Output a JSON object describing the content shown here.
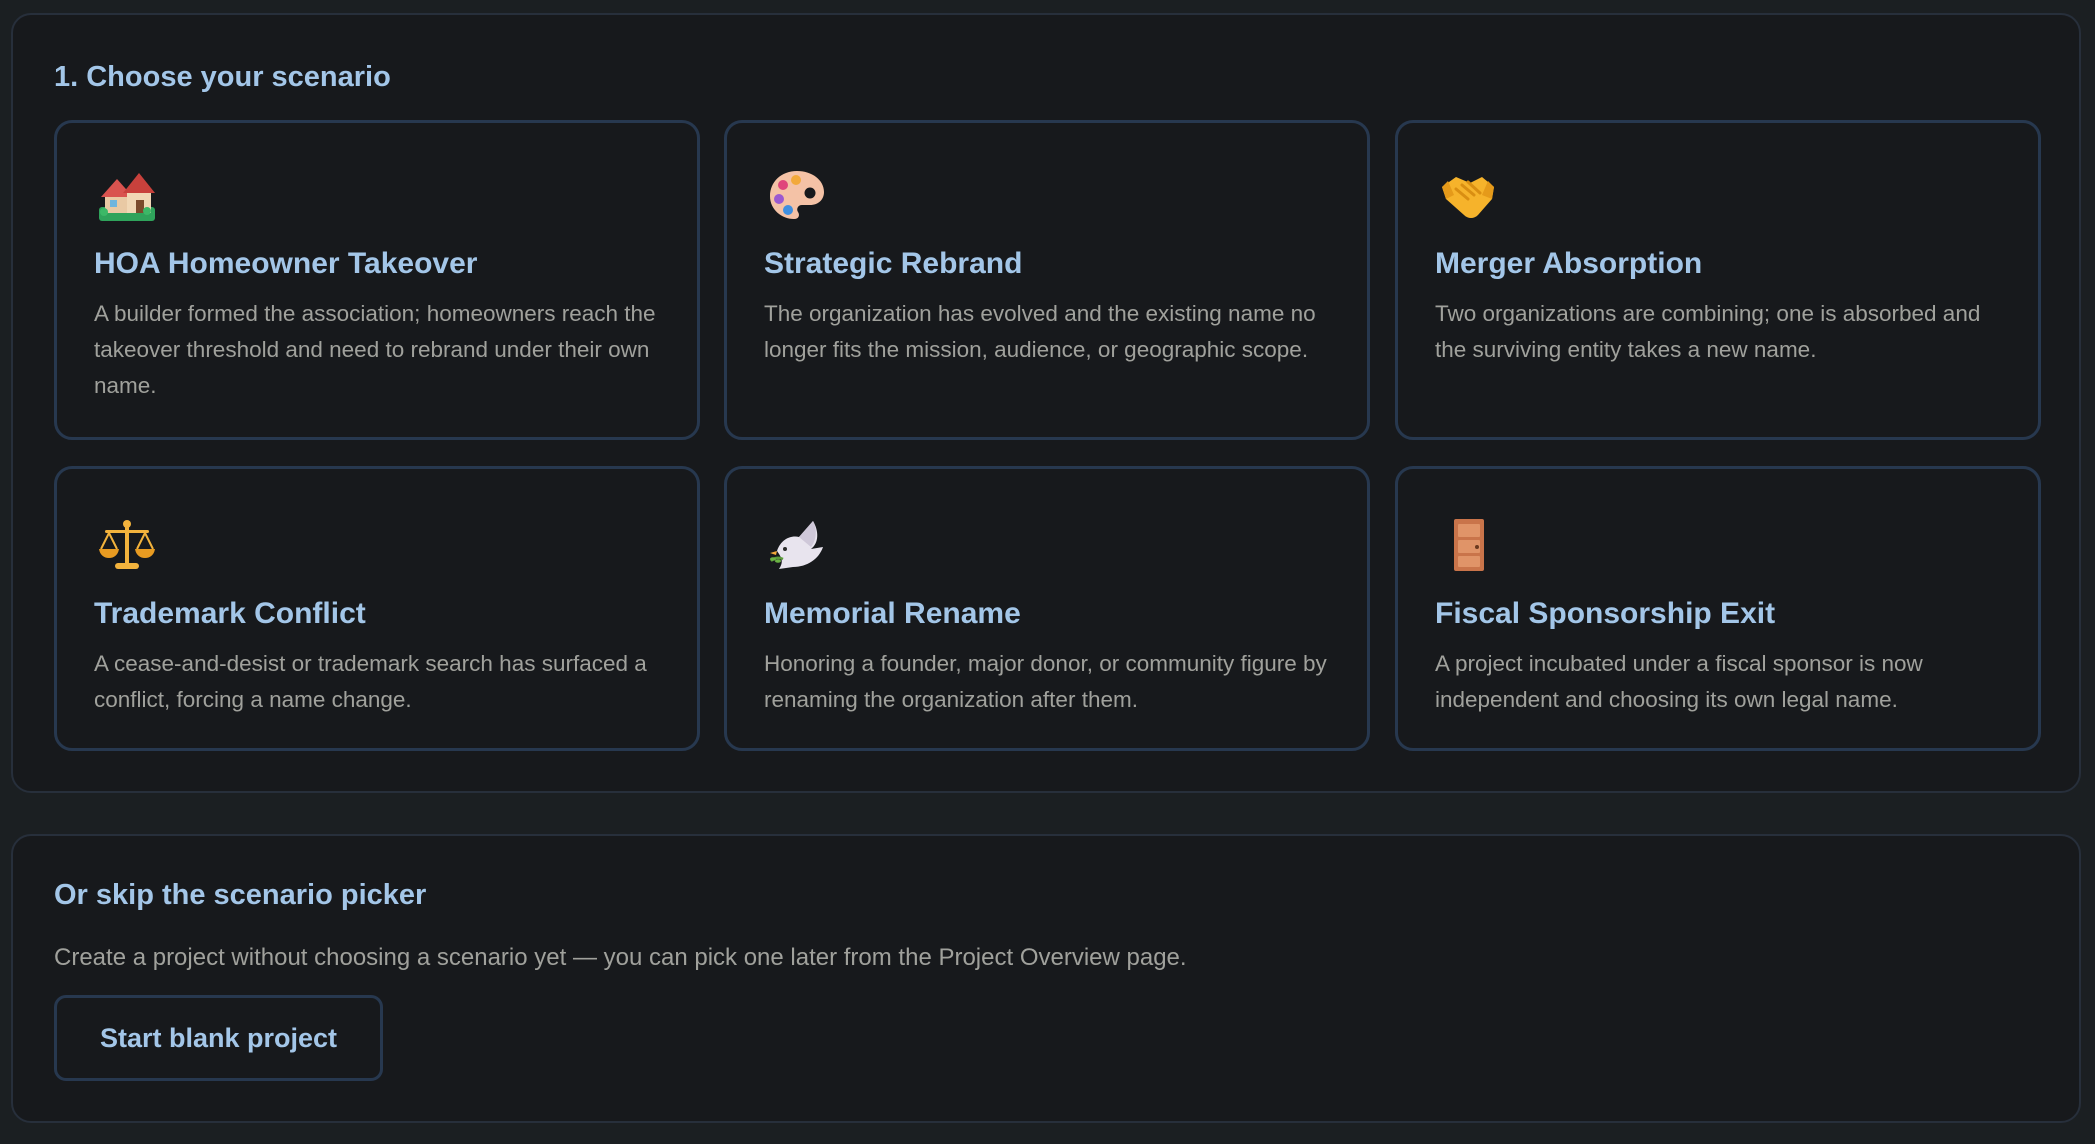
{
  "scenario_section": {
    "heading": "1. Choose your scenario",
    "cards": [
      {
        "icon": "house-icon",
        "title": "HOA Homeowner Takeover",
        "description": "A builder formed the association; homeowners reach the takeover threshold and need to rebrand under their own name."
      },
      {
        "icon": "palette-icon",
        "title": "Strategic Rebrand",
        "description": "The organization has evolved and the existing name no longer fits the mission, audience, or geographic scope."
      },
      {
        "icon": "handshake-icon",
        "title": "Merger Absorption",
        "description": "Two organizations are combining; one is absorbed and the surviving entity takes a new name."
      },
      {
        "icon": "scales-icon",
        "title": "Trademark Conflict",
        "description": "A cease-and-desist or trademark search has surfaced a conflict, forcing a name change."
      },
      {
        "icon": "dove-icon",
        "title": "Memorial Rename",
        "description": "Honoring a founder, major donor, or community figure by renaming the organization after them."
      },
      {
        "icon": "door-icon",
        "title": "Fiscal Sponsorship Exit",
        "description": "A project incubated under a fiscal sponsor is now independent and choosing its own legal name."
      }
    ]
  },
  "skip_section": {
    "heading": "Or skip the scenario picker",
    "description": "Create a project without choosing a scenario yet — you can pick one later from the Project Overview page.",
    "button_label": "Start blank project"
  },
  "colors": {
    "page_background": "#1b1f22",
    "panel_background": "#17191c",
    "accent_text": "#a3c6e8",
    "muted_text": "#a0a19c",
    "card_border": "#27384f"
  }
}
